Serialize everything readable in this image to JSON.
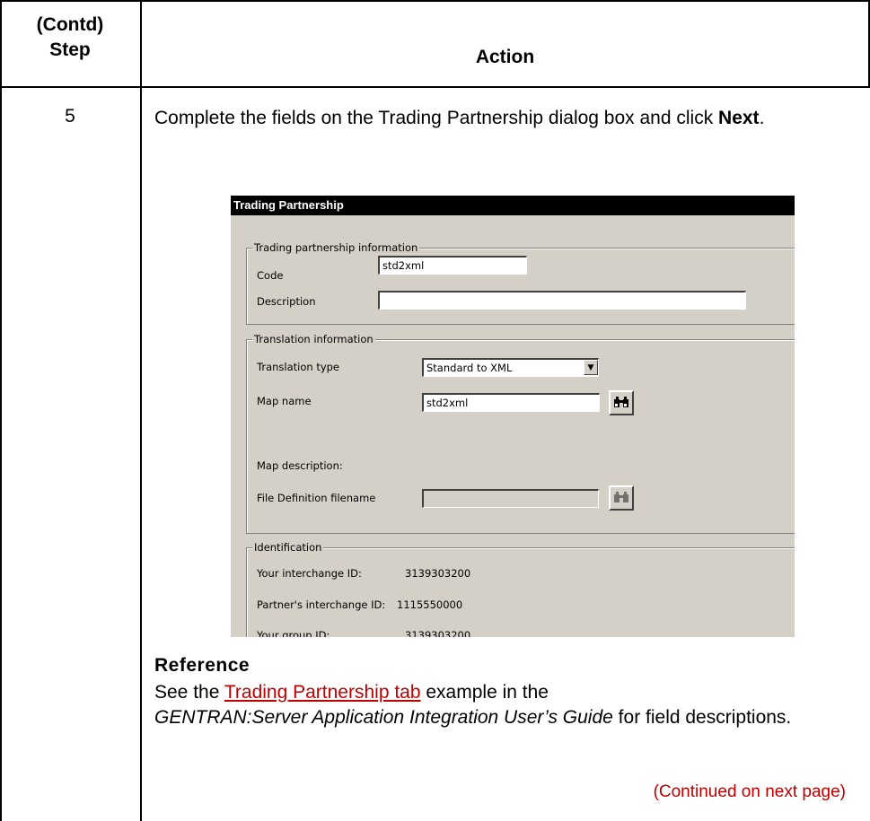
{
  "table": {
    "header_step_line1": "(Contd)",
    "header_step_line2": "Step",
    "header_action": "Action"
  },
  "row": {
    "step": "5",
    "instruction_text": "Complete the fields on the Trading Partnership dialog box and click ",
    "instruction_bold": "Next",
    "instruction_end": "."
  },
  "dialog": {
    "title": "Trading Partnership",
    "group_partnership": "Trading partnership information",
    "code_label": "Code",
    "code_value": "std2xml",
    "description_label": "Description",
    "description_value": "",
    "group_translation": "Translation information",
    "translation_type_label": "Translation type",
    "translation_type_value": "Standard to XML",
    "map_name_label": "Map name",
    "map_name_value": "std2xml",
    "map_description_label": "Map description:",
    "file_def_label": "File Definition filename",
    "file_def_value": "",
    "group_identification": "Identification",
    "your_interchange_label": "Your interchange ID:",
    "your_interchange_value": "3139303200",
    "partner_interchange_label": "Partner's interchange ID:",
    "partner_interchange_value": "1115550000",
    "your_group_label": "Your group ID:",
    "your_group_value": "3139303200",
    "icons": [
      "binoculars-icon",
      "dropdown-arrow-icon"
    ]
  },
  "reference": {
    "heading": "Reference",
    "text_before_link": "See the ",
    "link_text": "Trading Partnership tab",
    "text_after_link": " example in the ",
    "guide_title": "GENTRAN:Server Application Integration User’s Guide",
    "text_end": " for field descriptions."
  },
  "continued": "(Continued on next page)",
  "colors": {
    "link": "#c00000",
    "dialog_bg": "#d4d0c8",
    "title_bar": "#000000"
  }
}
